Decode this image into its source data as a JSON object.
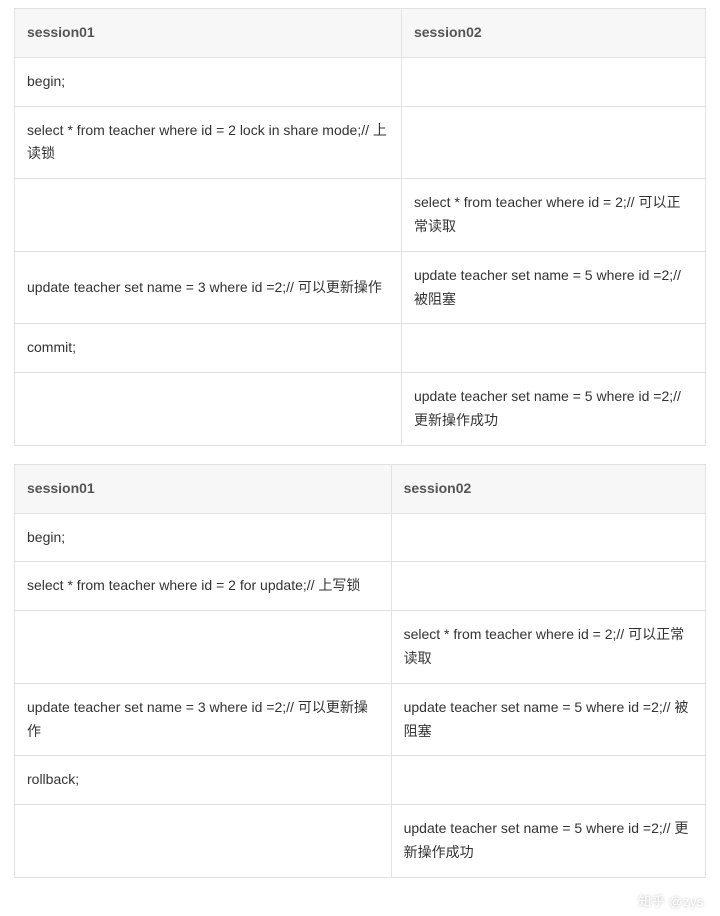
{
  "table1": {
    "headers": [
      "session01",
      "session02"
    ],
    "rows": [
      [
        "begin;",
        ""
      ],
      [
        "select * from teacher where id = 2 lock in share mode;// 上读锁",
        ""
      ],
      [
        "",
        "select * from teacher where id = 2;// 可以正常读取"
      ],
      [
        "update teacher set name = 3 where id =2;// 可以更新操作",
        "update teacher set name = 5 where id =2;// 被阻塞"
      ],
      [
        "commit;",
        ""
      ],
      [
        "",
        "update teacher set name = 5 where id =2;// 更新操作成功"
      ]
    ]
  },
  "table2": {
    "headers": [
      "session01",
      "session02"
    ],
    "rows": [
      [
        "begin;",
        ""
      ],
      [
        "select * from teacher where id = 2 for update;// 上写锁",
        ""
      ],
      [
        "",
        "select * from teacher where id = 2;// 可以正常读取"
      ],
      [
        "update teacher set name = 3 where id =2;// 可以更新操作",
        "update teacher set name = 5 where id =2;// 被阻塞"
      ],
      [
        "rollback;",
        ""
      ],
      [
        "",
        "update teacher set name = 5 where id =2;// 更新操作成功"
      ]
    ]
  },
  "watermark": "知乎 @zys"
}
